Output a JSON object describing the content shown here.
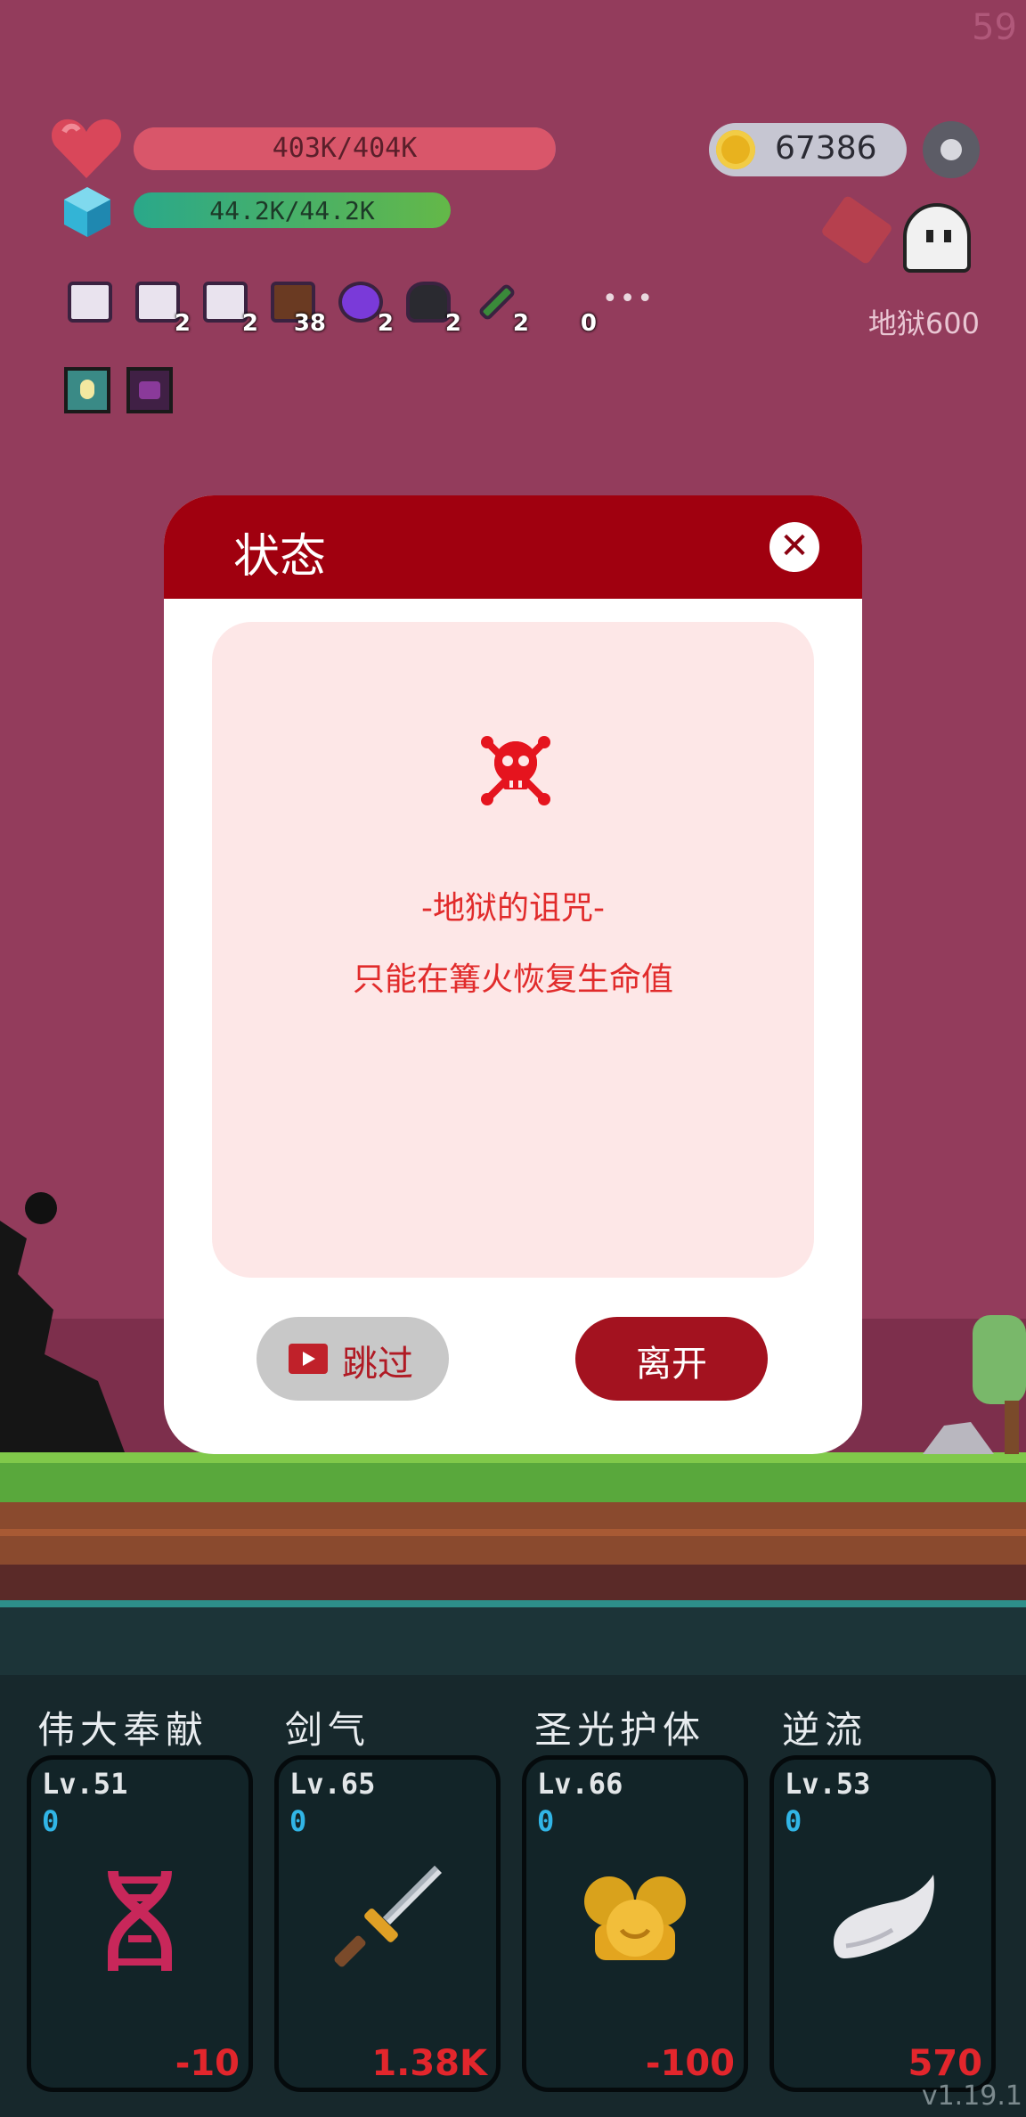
{
  "hud": {
    "fps": "59",
    "hp": {
      "text": "403K/404K",
      "fraction": 0.9975
    },
    "mp": {
      "text": "44.2K/44.2K",
      "fraction": 1.0
    },
    "coins": "67386",
    "area": "地狱600",
    "buffs": [
      {
        "name": "scroll",
        "count": ""
      },
      {
        "name": "scroll",
        "count": "2"
      },
      {
        "name": "scroll",
        "count": "2"
      },
      {
        "name": "pirate-ship",
        "count": "38"
      },
      {
        "name": "crystal-ball",
        "count": "2"
      },
      {
        "name": "cauldron",
        "count": "2"
      },
      {
        "name": "wrench-tools",
        "count": "2"
      },
      {
        "name": "blank",
        "count": "0"
      }
    ],
    "more": "•••"
  },
  "modal": {
    "title": "状态",
    "close": "✕",
    "curse_title": "-地狱的诅咒-",
    "curse_desc": "只能在篝火恢复生命值",
    "skip": "跳过",
    "leave": "离开"
  },
  "skills": [
    {
      "name": "伟大奉献",
      "level": "Lv.51",
      "zero": "0",
      "value": "-10",
      "icon": "dna-icon"
    },
    {
      "name": "剑气",
      "level": "Lv.65",
      "zero": "0",
      "value": "1.38K",
      "icon": "sword-icon"
    },
    {
      "name": "圣光护体",
      "level": "Lv.66",
      "zero": "0",
      "value": "-100",
      "icon": "golden-shield-icon"
    },
    {
      "name": "逆流",
      "level": "Lv.53",
      "zero": "0",
      "value": "570",
      "icon": "wing-icon"
    }
  ],
  "version": "v1.19.1",
  "colors": {
    "modal_header": "#a0000f",
    "curse_text": "#e12b2b",
    "leave_button": "#a3121f"
  }
}
